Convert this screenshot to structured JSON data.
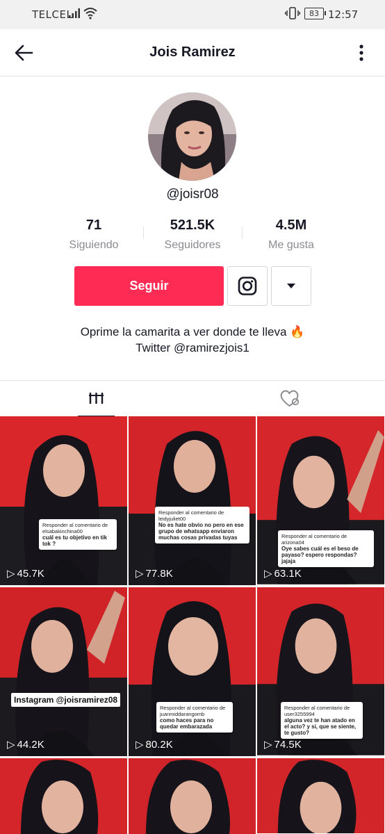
{
  "status_bar": {
    "carrier": "TELCEL",
    "battery": "83",
    "time": "12:57"
  },
  "header": {
    "title": "Jois Ramirez",
    "back_icon": "arrow-left-icon",
    "more_icon": "vertical-dots-icon"
  },
  "profile": {
    "handle": "@joisr08",
    "stats": [
      {
        "value": "71",
        "label": "Siguiendo"
      },
      {
        "value": "521.5K",
        "label": "Seguidores"
      },
      {
        "value": "4.5M",
        "label": "Me gusta"
      }
    ],
    "follow_label": "Seguir",
    "bio_line1": "Oprime la camarita a ver donde te lleva 🔥",
    "bio_line2": "Twitter @ramirezjois1"
  },
  "tabs": [
    {
      "icon": "grid-icon",
      "active": true
    },
    {
      "icon": "liked-heart-icon",
      "active": false
    }
  ],
  "colors": {
    "accent": "#fe2c55",
    "text": "#161823",
    "muted": "#8a8b91"
  },
  "videos": [
    {
      "views": "45.7K",
      "caption_small": "Responder al comentario de elsabakinchina00",
      "caption": "cuál es tu objetivo en tik tok ?"
    },
    {
      "views": "77.8K",
      "caption_small": "Responder al comentario de leidyjuliet00",
      "caption": "No es hate obvio no pero en ese grupo de whatsapp enviaron muchas cosas privadas tuyas"
    },
    {
      "views": "63.1K",
      "caption_small": "Responder al comentario de arizona04",
      "caption": "Oye sabes cuál es el beso de payaso? espero respondas? jajaja"
    },
    {
      "views": "44.2K",
      "caption_small": "",
      "caption": "Instagram @joisramirez08"
    },
    {
      "views": "80.2K",
      "caption_small": "Responder al comentario de juanmiddarangomb",
      "caption": "como haces para no quedar embarazada"
    },
    {
      "views": "74.5K",
      "caption_small": "Responder al comentario de user3255994",
      "caption": "alguna vez te han atado en el acto? y si, que se siente, te gusto?"
    },
    {
      "views": "",
      "caption_small": "",
      "caption": ""
    },
    {
      "views": "",
      "caption_small": "",
      "caption": ""
    },
    {
      "views": "",
      "caption_small": "",
      "caption": ""
    }
  ]
}
